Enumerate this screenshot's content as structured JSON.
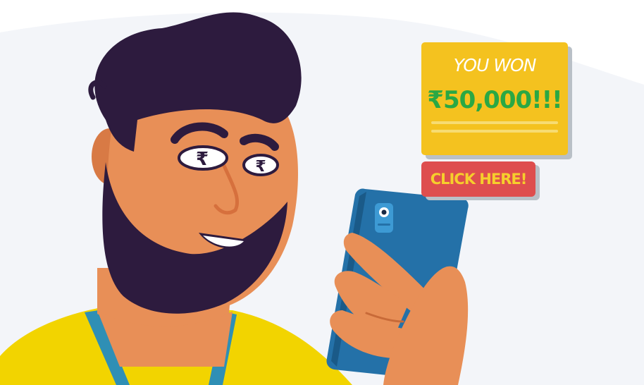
{
  "popup": {
    "heading": "YOU WON",
    "amount": "₹50,000!!!"
  },
  "cta": {
    "label": "CLICK HERE!"
  },
  "eyes": {
    "symbol": "₹"
  },
  "colors": {
    "popup_background": "#f4c21f",
    "prize_text": "#2aa844",
    "button_background": "#de4e4e",
    "button_text": "#f6cf2c",
    "phone": "#2471a8",
    "skin": "#e88f57",
    "hair": "#2d1b3e",
    "shirt": "#f2d400"
  }
}
